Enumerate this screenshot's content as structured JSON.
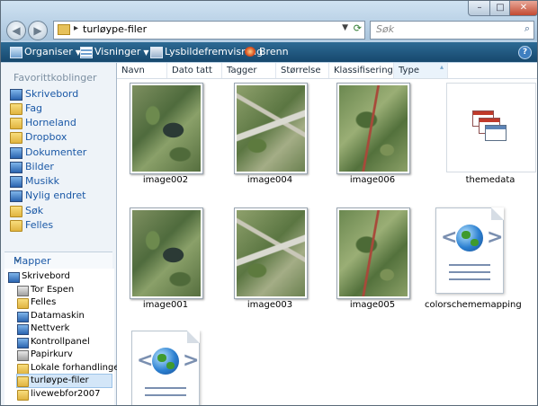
{
  "window": {
    "address_path": "turløype-filer",
    "search_placeholder": "Søk",
    "controls": {
      "minimize": "–",
      "maximize": "□",
      "close": "✕"
    },
    "back": "◀",
    "forward": "▶"
  },
  "toolbar": {
    "items": [
      {
        "label": "Organiser",
        "icon": "organize-icon",
        "has_dropdown": true
      },
      {
        "label": "Visninger",
        "icon": "views-icon",
        "has_dropdown": true
      },
      {
        "label": "Lysbildefremvisning",
        "icon": "slideshow-icon",
        "has_dropdown": false
      },
      {
        "label": "Brenn",
        "icon": "burn-icon",
        "has_dropdown": false
      }
    ],
    "help": "?"
  },
  "nav": {
    "favorites_header": "Favorittkoblinger",
    "favorites": [
      {
        "label": "Skrivebord",
        "icon": "desktop-icon"
      },
      {
        "label": "Fag",
        "icon": "folder-icon"
      },
      {
        "label": "Horneland",
        "icon": "folder-icon"
      },
      {
        "label": "Dropbox",
        "icon": "folder-icon"
      },
      {
        "label": "Dokumenter",
        "icon": "documents-icon"
      },
      {
        "label": "Bilder",
        "icon": "pictures-icon"
      },
      {
        "label": "Musikk",
        "icon": "music-icon"
      },
      {
        "label": "Nylig endret",
        "icon": "recent-icon"
      },
      {
        "label": "Søk",
        "icon": "search-icon"
      },
      {
        "label": "Felles",
        "icon": "folder-icon"
      }
    ],
    "folders_header": "Mapper",
    "tree": [
      {
        "label": "Skrivebord",
        "icon": "desktop-icon",
        "level": 0
      },
      {
        "label": "Tor Espen",
        "icon": "user-folder-icon",
        "level": 1
      },
      {
        "label": "Felles",
        "icon": "folder-icon",
        "level": 1
      },
      {
        "label": "Datamaskin",
        "icon": "computer-icon",
        "level": 1
      },
      {
        "label": "Nettverk",
        "icon": "network-icon",
        "level": 1
      },
      {
        "label": "Kontrollpanel",
        "icon": "control-panel-icon",
        "level": 1
      },
      {
        "label": "Papirkurv",
        "icon": "recycle-bin-icon",
        "level": 1
      },
      {
        "label": "Lokale forhandlinger",
        "icon": "folder-icon",
        "level": 1
      },
      {
        "label": "turløype-filer",
        "icon": "folder-icon",
        "level": 1,
        "selected": true
      },
      {
        "label": "livewebfor2007",
        "icon": "folder-icon",
        "level": 1
      }
    ]
  },
  "columns": [
    "Navn",
    "Dato tatt",
    "Tagger",
    "Størrelse",
    "Klassifisering",
    "Type"
  ],
  "files": [
    {
      "name": "image002",
      "kind": "map-a"
    },
    {
      "name": "image004",
      "kind": "map-b"
    },
    {
      "name": "image006",
      "kind": "map-c"
    },
    {
      "name": "themedata",
      "kind": "presentation"
    },
    {
      "name": "image001",
      "kind": "map-a"
    },
    {
      "name": "image003",
      "kind": "map-b"
    },
    {
      "name": "image005",
      "kind": "map-c"
    },
    {
      "name": "colorschememapping",
      "kind": "xml-globe"
    },
    {
      "name": "",
      "kind": "xml-globe"
    }
  ],
  "colors": {
    "toolbar_bg": "#1f5580",
    "link_blue": "#1a58a6",
    "selection": "#d3e6f8"
  }
}
